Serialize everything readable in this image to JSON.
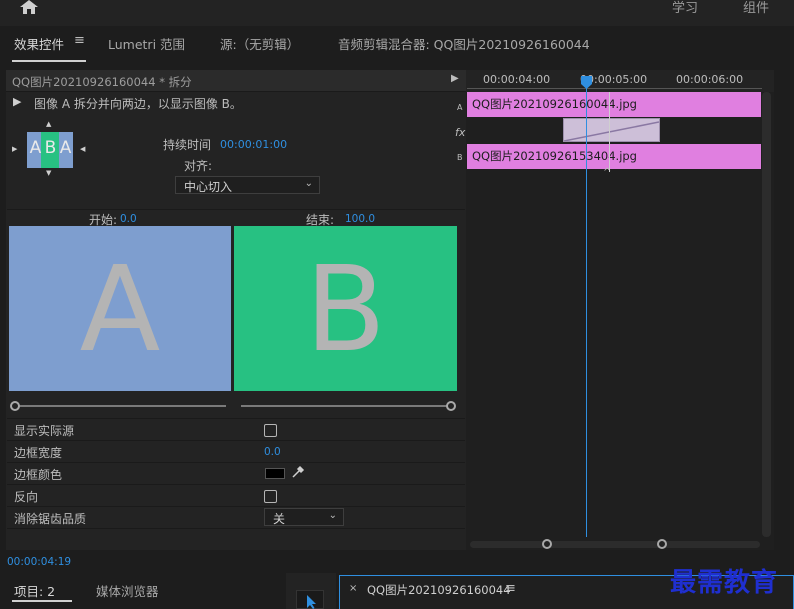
{
  "workspace": {
    "items": [
      "学习",
      "组件"
    ]
  },
  "tabs": {
    "effect_controls": "效果控件",
    "lumetri_scope": "Lumetri 范围",
    "source": "源:（无剪辑）",
    "audio_mixer": "音频剪辑混合器: QQ图片20210926160044"
  },
  "effect": {
    "sequence_title": "QQ图片20210926160044 * 拆分",
    "description": "图像 A 拆分并向两边，以显示图像 B。",
    "duration_label": "持续时间",
    "duration_value": "00:00:01:00",
    "align_label": "对齐:",
    "align_value": "中心切入",
    "start_label": "开始:",
    "start_value": "0.0",
    "end_label": "结束:",
    "end_value": "100.0",
    "thumb_letters": "A B A",
    "preview_a": "A",
    "preview_b": "B",
    "show_actual_source": "显示实际源",
    "border_width_label": "边框宽度",
    "border_width_value": "0.0",
    "border_color_label": "边框颜色",
    "reverse_label": "反向",
    "antialias_label": "消除锯齿品质",
    "antialias_value": "关",
    "current_time": "00:00:04:19"
  },
  "timeline": {
    "ruler": [
      "00:00:04:00",
      "00:00:05:00",
      "00:00:06:00"
    ],
    "track_a_label": "A",
    "track_b_label": "B",
    "fx_label": "fx",
    "clip_a": "QQ图片20210926160044.jpg",
    "clip_b": "QQ图片20210926153404.jpg"
  },
  "bottom": {
    "project": "项目: 2",
    "media_browser": "媒体浏览器",
    "sequence_tab": "QQ图片20210926160044"
  },
  "watermark": "最需教育",
  "colors": {
    "accent_blue": "#2f8fe0",
    "clip_pink": "#e07fe0",
    "preview_a": "#7e9ecf",
    "preview_b": "#27c182"
  }
}
